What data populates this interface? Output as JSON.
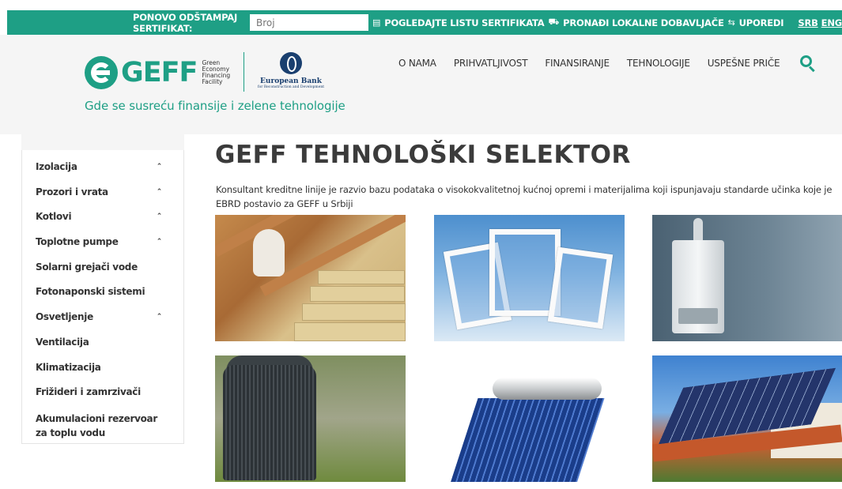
{
  "topbar": {
    "reprint_label": "PONOVO ODŠTAMPAJ SERTIFIKAT:",
    "cert_placeholder": "Broj",
    "links": [
      {
        "icon": "document-icon",
        "label": "POGLEDAJTE LISTU SERTIFIKATA"
      },
      {
        "icon": "truck-icon",
        "label": "PRONAĐI LOKALNE DOBAVLJAČE"
      },
      {
        "icon": "compare-icon",
        "label": "UPOREDI"
      }
    ],
    "lang_srb": "SRB",
    "lang_eng": "ENG"
  },
  "header": {
    "logo_text": "GEFF",
    "logo_sub": [
      "Green",
      "Economy",
      "Financing",
      "Facility"
    ],
    "ebrd_name": "European Bank",
    "ebrd_sub": "for Reconstruction and Development",
    "tagline": "Gde se susreću finansije i zelene tehnologije"
  },
  "nav": [
    "O NAMA",
    "PRIHVATLJIVOST",
    "FINANSIRANJE",
    "TEHNOLOGIJE",
    "USPEŠNE PRIČE"
  ],
  "sidebar": {
    "items": [
      {
        "label": "Izolacija",
        "expandable": true
      },
      {
        "label": "Prozori i vrata",
        "expandable": true
      },
      {
        "label": "Kotlovi",
        "expandable": true
      },
      {
        "label": "Toplotne pumpe",
        "expandable": true
      },
      {
        "label": "Solarni grejači vode",
        "expandable": false
      },
      {
        "label": "Fotonaponski sistemi",
        "expandable": false
      },
      {
        "label": "Osvetljenje",
        "expandable": true
      },
      {
        "label": "Ventilacija",
        "expandable": false
      },
      {
        "label": "Klimatizacija",
        "expandable": false
      },
      {
        "label": "Frižideri i zamrzivači",
        "expandable": false
      },
      {
        "label": "Akumulacioni rezervoar za toplu vodu",
        "expandable": false
      }
    ]
  },
  "main": {
    "title": "GEFF TEHNOLOŠKI SELEKTOR",
    "intro": "Konsultant kreditne linije je razvio bazu podataka o visokokvalitetnoj kućnoj opremi i materijalima koji ispunjavaju standarde učinka koje je EBRD postavio za GEFF u Srbiji"
  },
  "colors": {
    "brand_green": "#1e9f85",
    "header_bg": "#f5f5f5",
    "ebrd_blue": "#1a3f6f"
  }
}
